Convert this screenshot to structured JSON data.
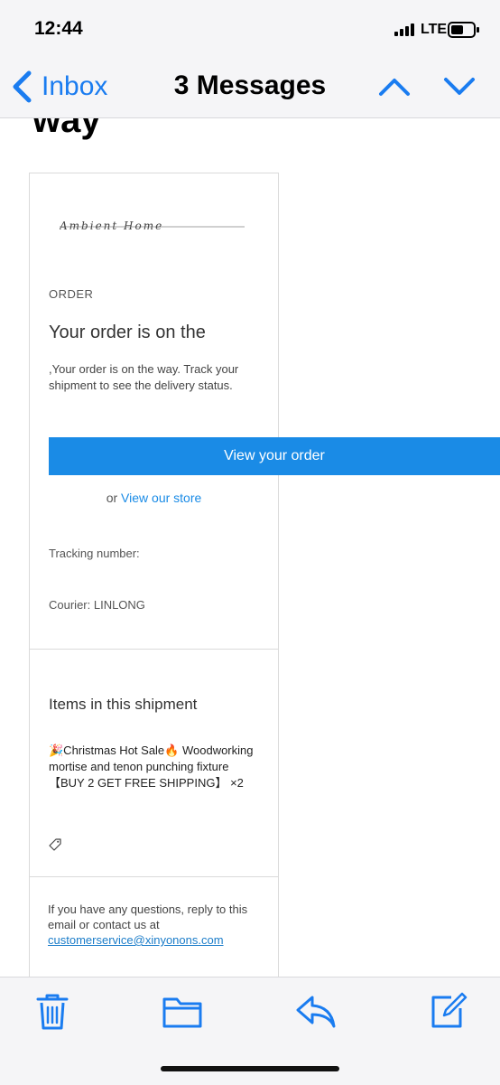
{
  "status_bar": {
    "time": "12:44",
    "carrier": "LTE"
  },
  "nav": {
    "back_label": "Inbox",
    "title": "3 Messages"
  },
  "email": {
    "heading_fragment": "way",
    "logo_text": "Ambient Home",
    "order_label": "ORDER",
    "title": "Your order is on the",
    "message": ",Your order is on the way. Track your shipment to see the delivery status.",
    "view_order_button": "View your order",
    "store_prefix": "or",
    "store_link": "View our store",
    "tracking_label": "Tracking number:",
    "courier_label": "Courier: LINLONG",
    "items_heading": "Items in this shipment",
    "item_text": "🎉Christmas Hot Sale🔥 Woodworking mortise and tenon punching fixture【BUY 2 GET FREE SHIPPING】 ×2",
    "footer_text": "If you have any questions, reply to this email or contact us at",
    "footer_email": "customerservice@xinyonons.com"
  },
  "toolbar": {
    "icons": [
      "trash-icon",
      "folder-icon",
      "reply-icon",
      "compose-icon"
    ]
  },
  "colors": {
    "accent": "#1a7cf0",
    "button": "#1a8be6",
    "bar_bg": "#f5f5f7"
  }
}
